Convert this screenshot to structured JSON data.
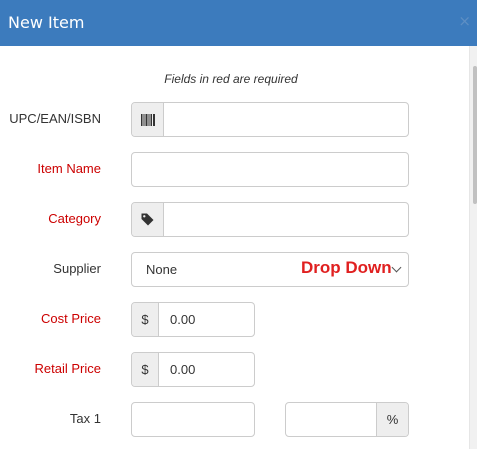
{
  "dialog": {
    "title": "New Item",
    "close_glyph": "×"
  },
  "form": {
    "required_note": "Fields in red are required",
    "fields": {
      "upc": {
        "label": "UPC/EAN/ISBN",
        "value": "",
        "icon": "barcode-icon",
        "required": false
      },
      "item_name": {
        "label": "Item Name",
        "value": "",
        "required": true
      },
      "category": {
        "label": "Category",
        "value": "",
        "icon": "tag-icon",
        "required": true
      },
      "supplier": {
        "label": "Supplier",
        "value": "None",
        "required": false,
        "annotation": "Drop Down"
      },
      "cost_price": {
        "label": "Cost Price",
        "prefix": "$",
        "value": "0.00",
        "required": true
      },
      "retail_price": {
        "label": "Retail Price",
        "prefix": "$",
        "value": "0.00",
        "required": true
      },
      "tax_1": {
        "label": "Tax 1",
        "name_value": "",
        "percent_value": "",
        "suffix": "%",
        "required": false
      }
    }
  },
  "colors": {
    "header": "#3c7bbd",
    "required_label": "#cc0000",
    "annotation": "#e02020"
  }
}
